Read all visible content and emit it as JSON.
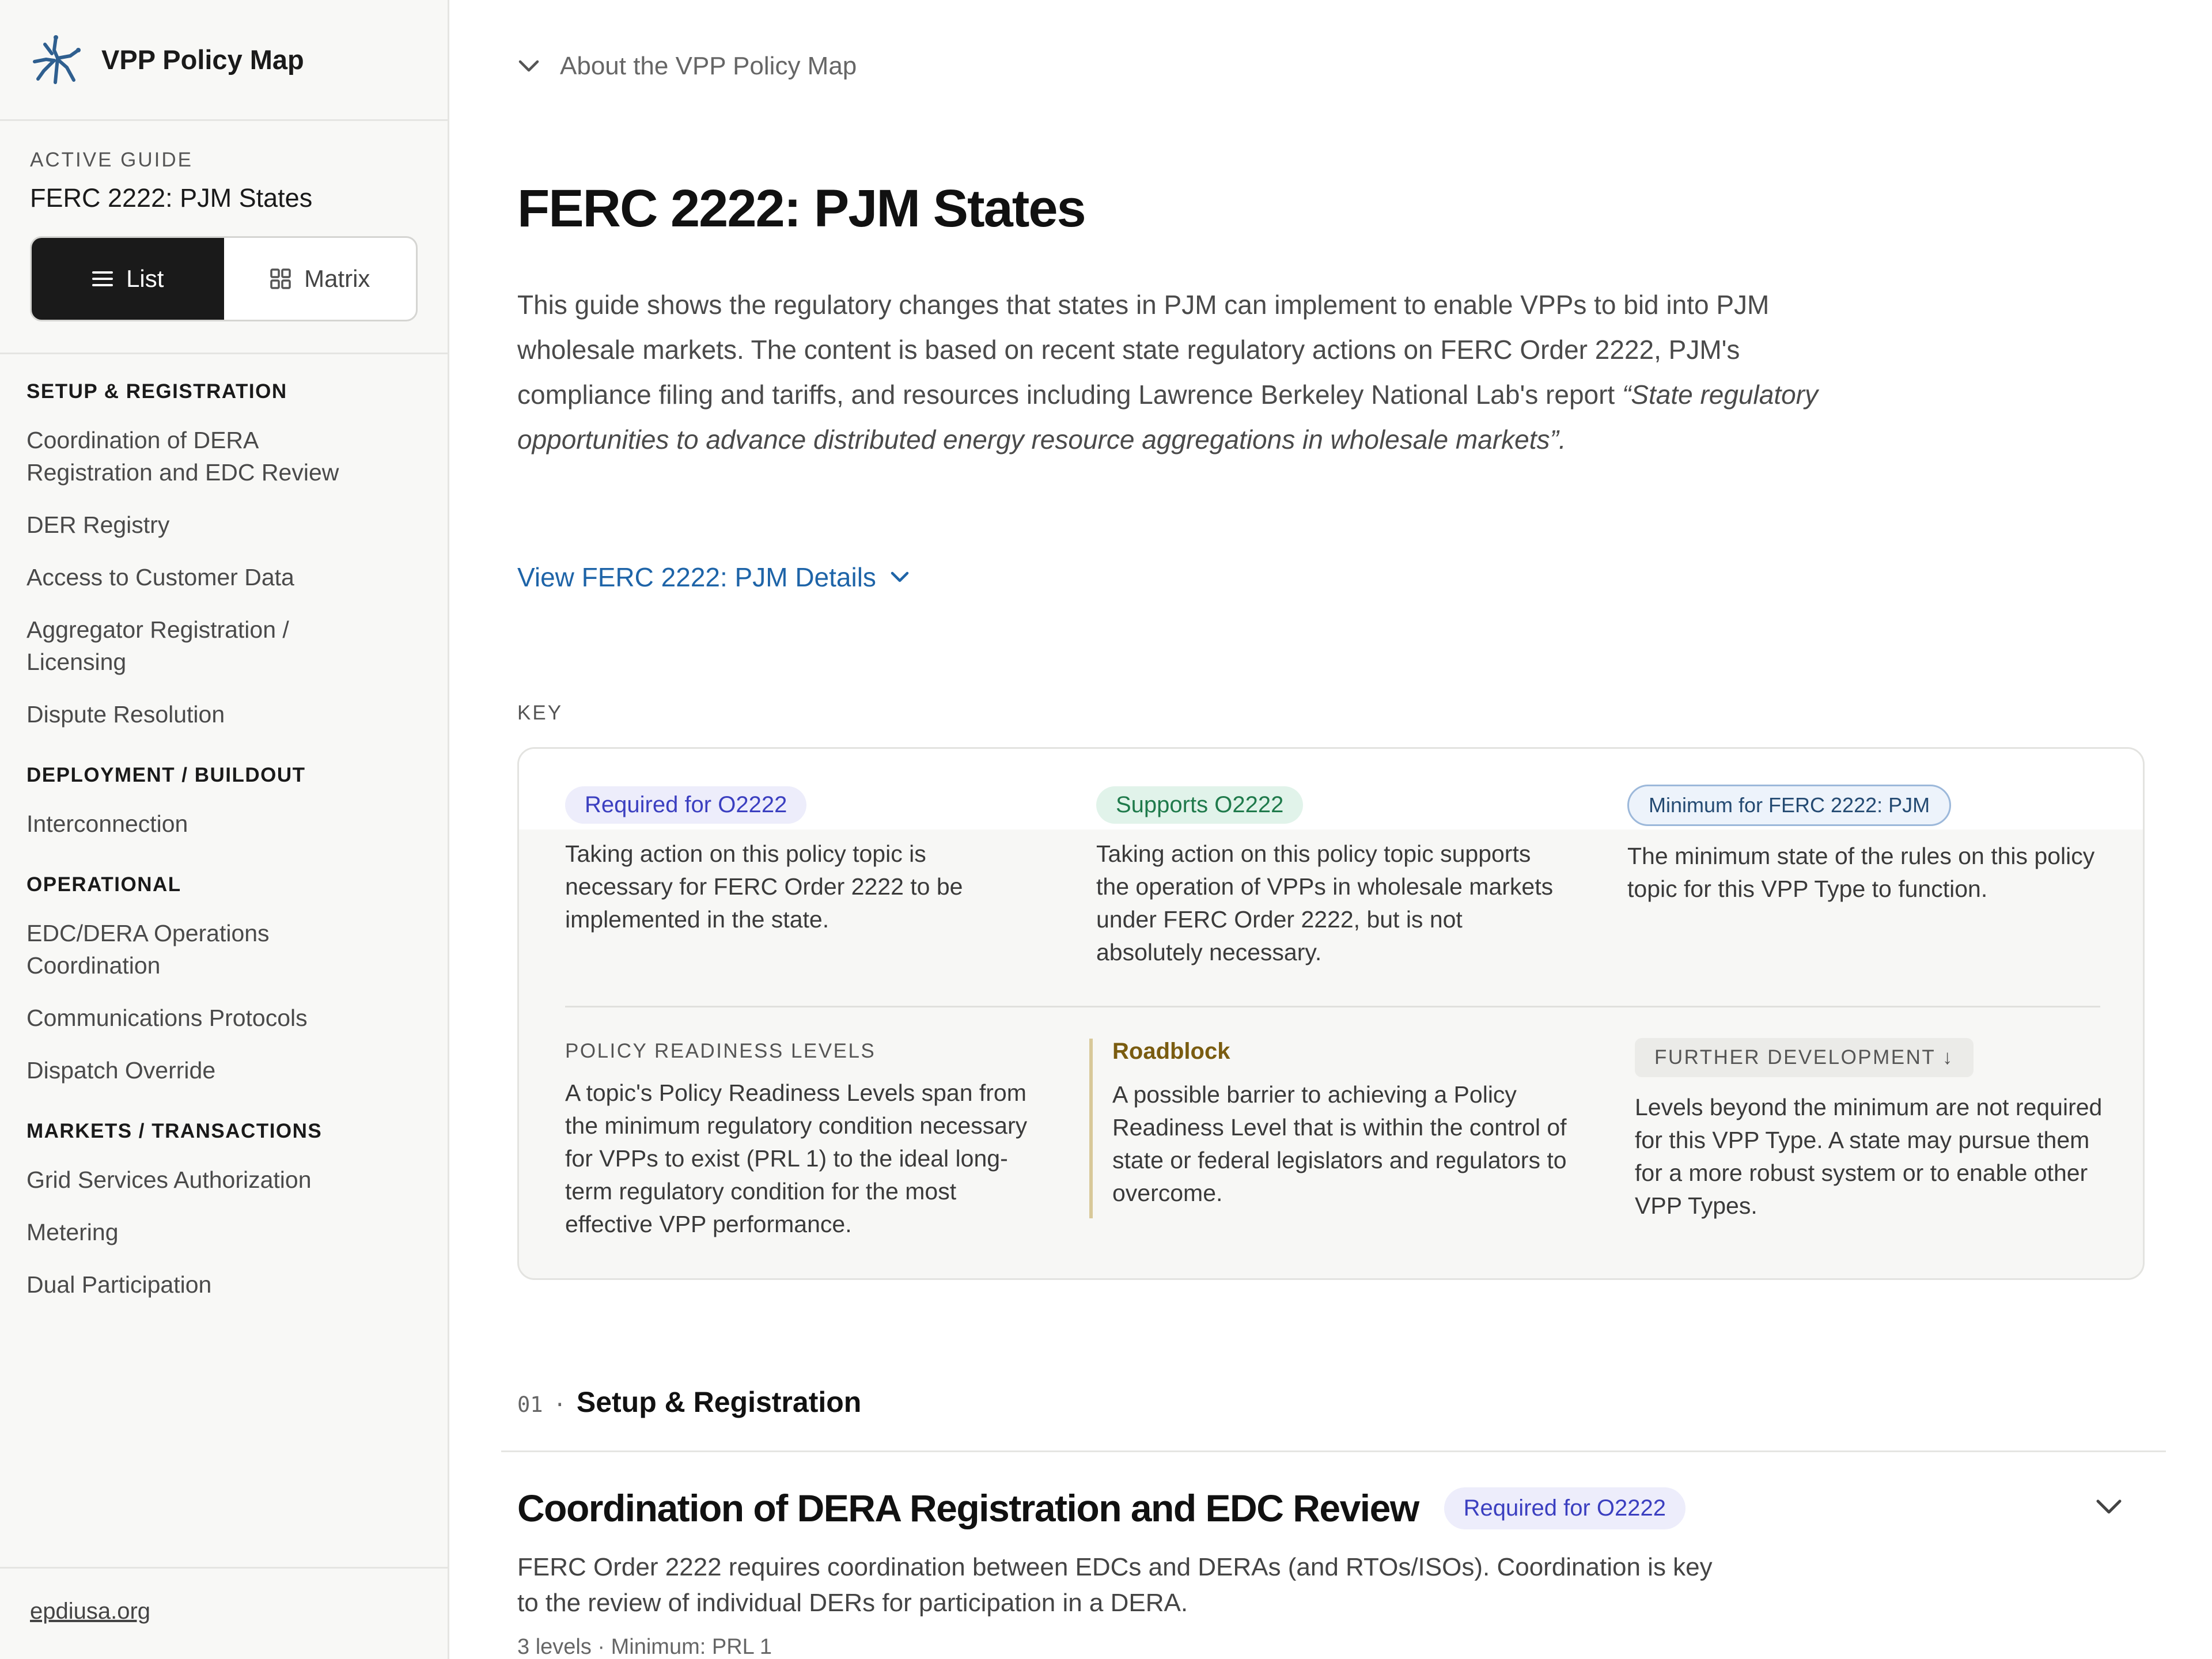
{
  "brand": {
    "title": "VPP Policy Map"
  },
  "guide": {
    "caption": "ACTIVE GUIDE",
    "name": "FERC 2222: PJM States",
    "view_list": "List",
    "view_matrix": "Matrix"
  },
  "nav": {
    "sections": [
      {
        "title": "SETUP & REGISTRATION",
        "items": [
          "Coordination of DERA Registration and EDC Review",
          "DER Registry",
          "Access to Customer Data",
          "Aggregator Registration / Licensing",
          "Dispute Resolution"
        ]
      },
      {
        "title": "DEPLOYMENT / BUILDOUT",
        "items": [
          "Interconnection"
        ]
      },
      {
        "title": "OPERATIONAL",
        "items": [
          "EDC/DERA Operations Coordination",
          "Communications Protocols",
          "Dispatch Override"
        ]
      },
      {
        "title": "MARKETS / TRANSACTIONS",
        "items": [
          "Grid Services Authorization",
          "Metering",
          "Dual Participation"
        ]
      }
    ]
  },
  "footer": {
    "link": "epdiusa.org"
  },
  "main": {
    "about": "About the VPP Policy Map",
    "title": "FERC 2222: PJM States",
    "intro_plain": "This guide shows the regulatory changes that states in PJM can implement to enable VPPs to bid into PJM wholesale markets. The content is based on recent state regulatory actions on FERC Order 2222, PJM's compliance filing and tariffs, and resources including Lawrence Berkeley National Lab's report ",
    "intro_quote": "“State regulatory opportunities to advance distributed energy resource aggregations in wholesale markets”.",
    "details_link": "View FERC 2222: PJM Details",
    "key_caption": "KEY"
  },
  "key": {
    "required_badge": "Required for O2222",
    "required_text": "Taking action on this policy topic is necessary for FERC Order 2222 to be implemented in the state.",
    "supports_badge": "Supports O2222",
    "supports_text": "Taking action on this policy topic supports the operation of VPPs in wholesale markets under FERC Order 2222, but is not absolutely necessary.",
    "minimum_badge": "Minimum for FERC 2222: PJM",
    "minimum_text": "The minimum state of the rules on this policy topic for this VPP Type to function.",
    "prl_caption": "POLICY READINESS LEVELS",
    "prl_text": "A topic's Policy Readiness Levels span from the minimum regulatory condition necessary for VPPs to exist (PRL 1) to the ideal long-term regulatory condition for the most effective VPP performance.",
    "roadblock_title": "Roadblock",
    "roadblock_text": "A possible barrier to achieving a Policy Readiness Level that is within the control of state or federal legislators and regulators to overcome.",
    "further_badge": "FURTHER DEVELOPMENT ↓",
    "further_text": "Levels beyond the minimum are not required for this VPP Type. A state may pursue them for a more robust system or to enable other VPP Types."
  },
  "section": {
    "number": "01",
    "separator": "·",
    "title": "Setup & Registration"
  },
  "topic": {
    "title": "Coordination of DERA Registration and EDC Review",
    "badge": "Required for O2222",
    "description": "FERC Order 2222 requires coordination between EDCs and DERAs (and RTOs/ISOs). Coordination is key to the review of individual DERs for participation in a DERA.",
    "meta": "3 levels · Minimum: PRL 1"
  },
  "colors": {
    "accent_link": "#1e64a8",
    "required": "#3b3fc0",
    "supports": "#1f7a4b",
    "roadblock": "#7a5c10",
    "logo": "#2f5f8f"
  },
  "icons": {
    "logo": "spark-logo-icon",
    "about_toggle": "chevron-down-icon",
    "list": "list-icon",
    "matrix": "grid-icon",
    "details_toggle": "chevron-down-icon",
    "topic_toggle": "chevron-down-icon"
  }
}
